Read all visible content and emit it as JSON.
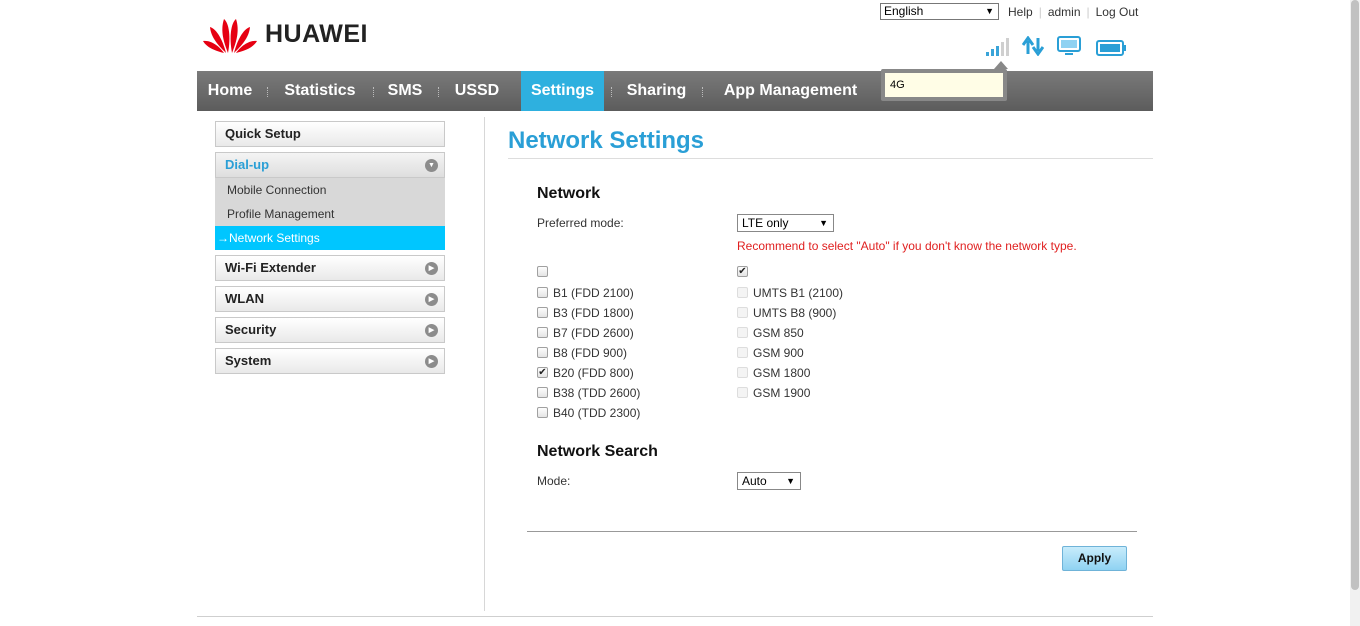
{
  "header": {
    "brand": "HUAWEI",
    "language": "English",
    "links": [
      "Help",
      "admin",
      "Log Out"
    ],
    "icons": [
      "signal-strength-icon",
      "data-transfer-icon",
      "computer-icon",
      "battery-icon"
    ],
    "tooltip": "4G"
  },
  "nav": {
    "items": [
      "Home",
      "Statistics",
      "SMS",
      "USSD",
      "Settings",
      "Sharing",
      "App Management"
    ],
    "active": "Settings"
  },
  "sidebar": {
    "quick_setup": "Quick Setup",
    "dialup": "Dial-up",
    "dialup_items": [
      "Mobile Connection",
      "Profile Management",
      "Network Settings"
    ],
    "active_arrow": "→",
    "wifi_extender": "Wi-Fi Extender",
    "wlan": "WLAN",
    "security": "Security",
    "system": "System"
  },
  "content": {
    "title": "Network Settings",
    "network_heading": "Network",
    "preferred_mode_label": "Preferred mode:",
    "preferred_mode_value": "LTE only",
    "hint": "Recommend to select \"Auto\" if you don't know the network type.",
    "lte_all_checked": false,
    "other_all_checked": true,
    "lte_bands": [
      {
        "label": "B1 (FDD 2100)",
        "checked": false
      },
      {
        "label": "B3 (FDD 1800)",
        "checked": false
      },
      {
        "label": "B7 (FDD 2600)",
        "checked": false
      },
      {
        "label": "B8 (FDD 900)",
        "checked": false
      },
      {
        "label": "B20 (FDD 800)",
        "checked": true
      },
      {
        "label": "B38 (TDD 2600)",
        "checked": false
      },
      {
        "label": "B40 (TDD 2300)",
        "checked": false
      }
    ],
    "other_bands": [
      {
        "label": "UMTS B1 (2100)",
        "checked": false
      },
      {
        "label": "UMTS B8 (900)",
        "checked": false
      },
      {
        "label": "GSM 850",
        "checked": false
      },
      {
        "label": "GSM 900",
        "checked": false
      },
      {
        "label": "GSM 1800",
        "checked": false
      },
      {
        "label": "GSM 1900",
        "checked": false
      }
    ],
    "search_heading": "Network Search",
    "mode_label": "Mode:",
    "mode_value": "Auto",
    "apply": "Apply"
  },
  "colors": {
    "accent": "#2a9fd6",
    "nav_active": "#2eb0df",
    "sidebar_active": "#00c6ff",
    "hint": "#e02020"
  }
}
